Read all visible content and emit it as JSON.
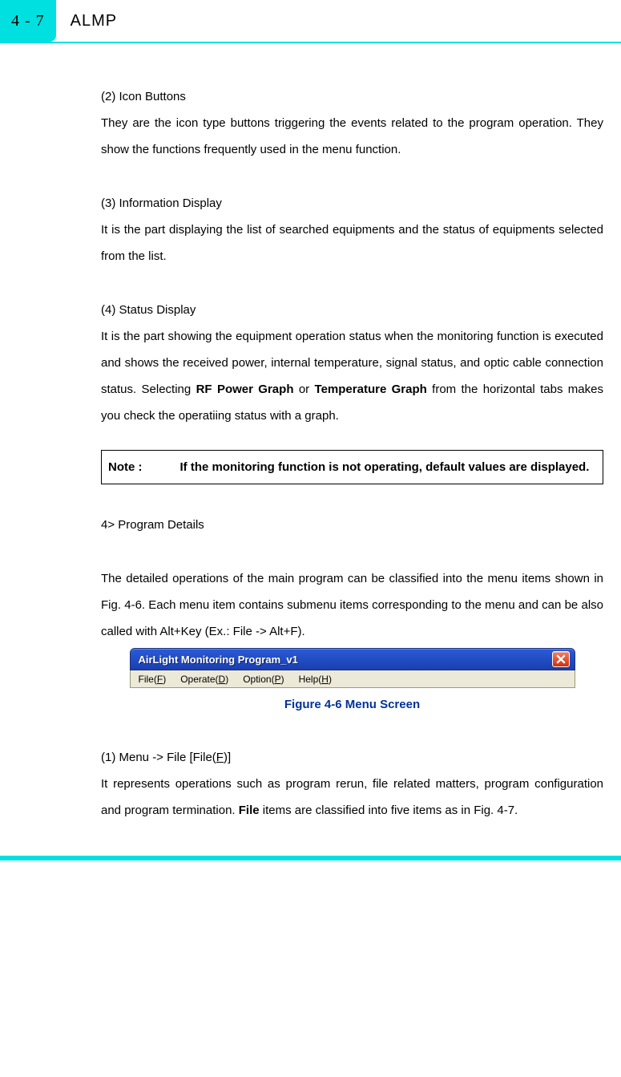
{
  "header": {
    "page_number": "4 - 7",
    "title": "ALMP"
  },
  "sections": {
    "s2": {
      "heading": "(2) Icon Buttons",
      "body": "They are the icon type buttons triggering the events related to the program operation. They show the functions frequently used in the menu function."
    },
    "s3": {
      "heading": "(3) Information Display",
      "body": "It is the part displaying the list of searched equipments and the status of equipments selected from the list."
    },
    "s4": {
      "heading": "(4) Status Display",
      "body_pre": "It is the part showing the equipment operation status when the monitoring function is executed and shows the received power, internal temperature, signal status, and optic cable connection status. Selecting ",
      "bold1": "RF Power Graph",
      "mid1": " or ",
      "bold2": "Temperature Graph",
      "body_post": " from the horizontal tabs makes you check the operatiing status with a graph."
    },
    "note": {
      "label": "Note :",
      "text": "If the monitoring function is not operating, default values are displayed."
    },
    "s_prog": {
      "heading": "4> Program Details",
      "body": "The detailed operations of the main program can be classified into the menu items shown in Fig. 4-6. Each menu item contains submenu items corresponding to the menu and can be also called with Alt+Key (Ex.: File -> Alt+F)."
    },
    "figure": {
      "window_title": "AirLight Monitoring Program_v1",
      "menu": {
        "file": {
          "label": "File(",
          "accel": "F",
          "tail": ")"
        },
        "operate": {
          "label": "Operate(",
          "accel": "D",
          "tail": ")"
        },
        "option": {
          "label": "Option(",
          "accel": "P",
          "tail": ")"
        },
        "help": {
          "label": "Help(",
          "accel": "H",
          "tail": ")"
        }
      },
      "caption": "Figure 4-6 Menu Screen"
    },
    "s_menu1": {
      "heading_pre": "(1) Menu -> File [File(",
      "heading_accel": "F",
      "heading_post": ")]",
      "body_pre": "It represents operations such as program rerun, file related matters, program configuration and program termination. ",
      "bold1": "File",
      "body_post": " items are classified into five items as in Fig. 4-7."
    }
  }
}
